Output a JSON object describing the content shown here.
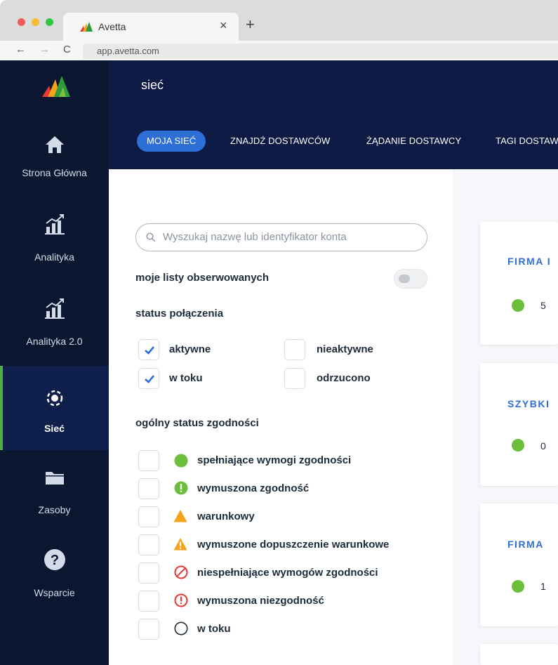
{
  "browser": {
    "tab_title": "Avetta",
    "tab_close": "×",
    "new_tab": "+",
    "back": "←",
    "forward": "→",
    "reload": "C",
    "url": "app.avetta.com"
  },
  "header": {
    "title": "sieć"
  },
  "topnav": {
    "items": [
      {
        "label": "MOJA SIEĆ",
        "active": true
      },
      {
        "label": "ZNAJDŹ DOSTAWCÓW"
      },
      {
        "label": "ŻĄDANIE DOSTAWCY"
      },
      {
        "label": "TAGI DOSTAW"
      }
    ]
  },
  "sidebar": {
    "items": [
      {
        "label": "Strona Główna",
        "icon": "home-icon"
      },
      {
        "label": "Analityka",
        "icon": "analytics-icon"
      },
      {
        "label": "Analityka 2.0",
        "icon": "analytics-icon"
      },
      {
        "label": "Sieć",
        "icon": "network-icon",
        "active": true
      },
      {
        "label": "Zasoby",
        "icon": "folder-icon"
      },
      {
        "label": "Wsparcie",
        "icon": "help-icon"
      }
    ]
  },
  "filters": {
    "search_placeholder": "Wyszukaj nazwę lub identyfikator konta",
    "watchlist_label": "moje listy obserwowanych",
    "watchlist_enabled": false,
    "connection_status_label": "status połączenia",
    "connection_status": [
      {
        "label": "aktywne",
        "checked": true
      },
      {
        "label": "nieaktywne",
        "checked": false
      },
      {
        "label": "w toku",
        "checked": true
      },
      {
        "label": "odrzucono",
        "checked": false
      }
    ],
    "compliance_label": "ogólny status zgodności",
    "compliance": [
      {
        "label": "spełniające wymogi zgodności",
        "icon": "green-circle-icon",
        "checked": false
      },
      {
        "label": "wymuszona zgodność",
        "icon": "green-exclamation-icon",
        "checked": false
      },
      {
        "label": "warunkowy",
        "icon": "orange-triangle-icon",
        "checked": false
      },
      {
        "label": "wymuszone dopuszczenie warunkowe",
        "icon": "orange-triangle-exclamation-icon",
        "checked": false
      },
      {
        "label": "niespełniające wymogów zgodności",
        "icon": "red-prohibited-icon",
        "checked": false
      },
      {
        "label": "wymuszona niezgodność",
        "icon": "red-exclamation-icon",
        "checked": false
      },
      {
        "label": "w toku",
        "icon": "empty-circle-icon",
        "checked": false
      }
    ]
  },
  "cards": [
    {
      "title": "FIRMA I",
      "count": "5"
    },
    {
      "title": "SZYBKI",
      "count": "0"
    },
    {
      "title": "FIRMA",
      "count": "1"
    }
  ],
  "colors": {
    "navy": "#0d1a44",
    "sidebar": "#0b1630",
    "accent_blue": "#2d6fd6",
    "green": "#6cbf3a",
    "orange": "#f7a21b",
    "red": "#e53935"
  }
}
